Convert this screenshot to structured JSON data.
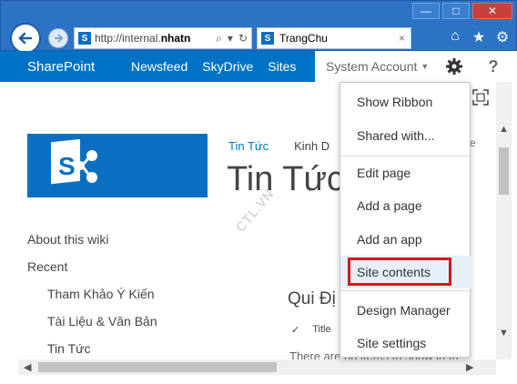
{
  "browser": {
    "address_prefix": "http://internal.",
    "address_host": "nhatn",
    "tab_title": "TrangChu",
    "tab_close": "×",
    "window_minimize": "—",
    "window_maximize": "□",
    "window_close": "✕"
  },
  "suitebar": {
    "brand": "SharePoint",
    "nav": [
      "Newsfeed",
      "SkyDrive",
      "Sites"
    ],
    "user": "System Account",
    "help": "?"
  },
  "site": {
    "header_links": [
      "Tin Tức",
      "Kinh D"
    ],
    "edit_snippet": "ite",
    "title": "Tin Tức",
    "watermark": "CTL.VN",
    "quick_launch": {
      "top": [
        "About this wiki",
        "Recent"
      ],
      "sub": [
        "Tham Khảo Ý Kiến",
        "Tài Liệu & Văn Bản",
        "Tin Tức"
      ]
    },
    "section_title": "Qui Đị",
    "column_check": "✓",
    "column_title": "Title",
    "empty_note": "There are no items to show in th"
  },
  "menu": {
    "items": [
      "Show Ribbon",
      "Shared with...",
      "Edit page",
      "Add a page",
      "Add an app",
      "Site contents",
      "Design Manager",
      "Site settings"
    ],
    "highlighted": "Site contents"
  },
  "colors": {
    "suitebar": "#0072c6",
    "ie_chrome": "#2d73c5",
    "highlight": "#d11a1a"
  }
}
